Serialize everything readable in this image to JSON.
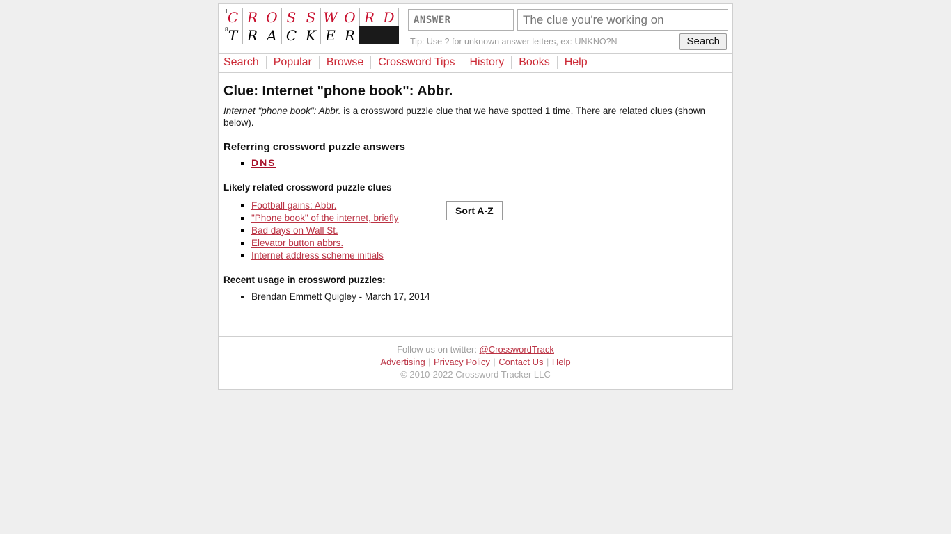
{
  "logo": {
    "row1": {
      "letters": [
        "C",
        "R",
        "O",
        "S",
        "S",
        "W",
        "O",
        "R",
        "D"
      ],
      "number": "1",
      "color": "#c8102e"
    },
    "row2": {
      "letters": [
        "T",
        "R",
        "A",
        "C",
        "K",
        "E",
        "R"
      ],
      "number": "8",
      "color": "#1a1a1a",
      "black_cells": 2
    }
  },
  "search": {
    "answer_placeholder": "ANSWER",
    "answer_value": "",
    "clue_placeholder": "The clue you're working on",
    "clue_value": "",
    "tip": "Tip: Use ? for unknown answer letters, ex: UNKNO?N",
    "search_button": "Search"
  },
  "nav": {
    "items": [
      {
        "label": "Search"
      },
      {
        "label": "Popular"
      },
      {
        "label": "Browse"
      },
      {
        "label": "Crossword Tips"
      },
      {
        "label": "History"
      },
      {
        "label": "Books"
      },
      {
        "label": "Help"
      }
    ]
  },
  "main": {
    "title": "Clue: Internet \"phone book\": Abbr.",
    "description_italic": "Internet \"phone book\": Abbr.",
    "description_rest": " is a crossword puzzle clue that we have spotted 1 time. There are related clues (shown below).",
    "answers_heading": "Referring crossword puzzle answers",
    "answers": [
      {
        "label": "DNS"
      }
    ],
    "related_heading": "Likely related crossword puzzle clues",
    "sort_button": "Sort A-Z",
    "related_clues": [
      {
        "label": "Football gains: Abbr."
      },
      {
        "label": "\"Phone book\" of the internet, briefly"
      },
      {
        "label": "Bad days on Wall St."
      },
      {
        "label": "Elevator button abbrs."
      },
      {
        "label": "Internet address scheme initials"
      }
    ],
    "usage_heading": "Recent usage in crossword puzzles:",
    "usage": [
      {
        "label": "Brendan Emmett Quigley - March 17, 2014"
      }
    ]
  },
  "footer": {
    "twitter_prefix": "Follow us on twitter: ",
    "twitter_handle": "@CrosswordTrack",
    "links": [
      {
        "label": "Advertising"
      },
      {
        "label": "Privacy Policy"
      },
      {
        "label": "Contact Us"
      },
      {
        "label": "Help"
      }
    ],
    "separator": "|",
    "copyright": "© 2010-2022 Crossword Tracker LLC"
  }
}
